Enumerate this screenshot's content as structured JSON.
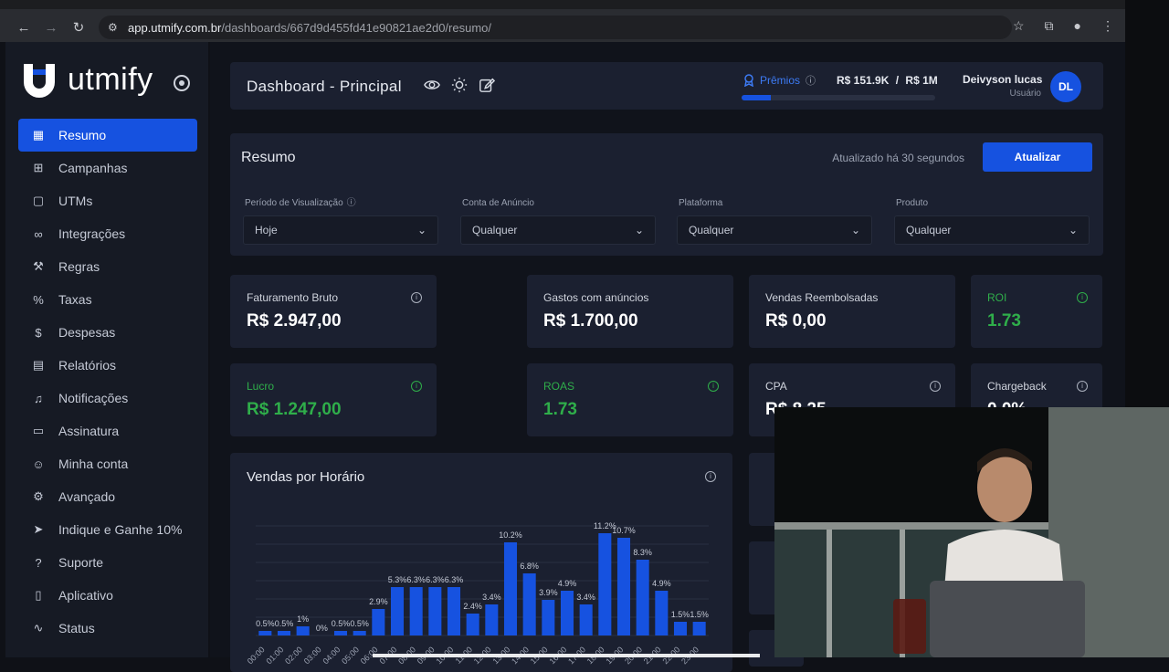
{
  "browser": {
    "url_host": "app.utmify.com.br",
    "url_path": "/dashboards/667d9d455fd41e90821ae2d0/resumo/"
  },
  "sidebar": {
    "logo_text": "utmify",
    "items": [
      {
        "label": "Resumo",
        "icon": "layout-icon"
      },
      {
        "label": "Campanhas",
        "icon": "folder-plus-icon"
      },
      {
        "label": "UTMs",
        "icon": "clipboard-icon"
      },
      {
        "label": "Integrações",
        "icon": "link-icon"
      },
      {
        "label": "Regras",
        "icon": "wrench-icon"
      },
      {
        "label": "Taxas",
        "icon": "percent-icon"
      },
      {
        "label": "Despesas",
        "icon": "dollar-icon"
      },
      {
        "label": "Relatórios",
        "icon": "file-icon"
      },
      {
        "label": "Notificações",
        "icon": "bell-icon"
      },
      {
        "label": "Assinatura",
        "icon": "card-icon"
      },
      {
        "label": "Minha conta",
        "icon": "user-icon"
      },
      {
        "label": "Avançado",
        "icon": "gear-icon"
      },
      {
        "label": "Indique e Ganhe 10%",
        "icon": "send-icon"
      },
      {
        "label": "Suporte",
        "icon": "help-icon"
      },
      {
        "label": "Aplicativo",
        "icon": "phone-icon"
      },
      {
        "label": "Status",
        "icon": "activity-icon"
      }
    ]
  },
  "topbar": {
    "title": "Dashboard - Principal",
    "premios_label": "Prêmios",
    "goal_current": "R$ 151.9K",
    "goal_separator": "/",
    "goal_target": "R$ 1M",
    "goal_progress": 0.15,
    "user_name": "Deivyson lucas",
    "user_role": "Usuário",
    "avatar_initials": "DL"
  },
  "resumo": {
    "title": "Resumo",
    "updated_text": "Atualizado há 30 segundos",
    "update_button": "Atualizar",
    "filters": [
      {
        "label": "Período de Visualização",
        "value": "Hoje"
      },
      {
        "label": "Conta de Anúncio",
        "value": "Qualquer"
      },
      {
        "label": "Plataforma",
        "value": "Qualquer"
      },
      {
        "label": "Produto",
        "value": "Qualquer"
      }
    ]
  },
  "kpis": {
    "faturamento": {
      "label": "Faturamento Bruto",
      "value": "R$ 2.947,00"
    },
    "gastos": {
      "label": "Gastos com anúncios",
      "value": "R$ 1.700,00"
    },
    "reembolsadas": {
      "label": "Vendas Reembolsadas",
      "value": "R$ 0,00"
    },
    "roi": {
      "label": "ROI",
      "value": "1.73"
    },
    "lucro": {
      "label": "Lucro",
      "value": "R$ 1.247,00"
    },
    "roas": {
      "label": "ROAS",
      "value": "1.73"
    },
    "cpa": {
      "label": "CPA",
      "value": "R$ 8,25"
    },
    "chargeback": {
      "label": "Chargeback",
      "value": "0,0%"
    }
  },
  "colors": {
    "accent": "#1652e0",
    "positive": "#2fae4a"
  },
  "chart_data": {
    "type": "bar",
    "title": "Vendas por Horário",
    "categories": [
      "00:00",
      "01:00",
      "02:00",
      "03:00",
      "04:00",
      "05:00",
      "06:00",
      "07:00",
      "08:00",
      "09:00",
      "10:00",
      "11:00",
      "12:00",
      "13:00",
      "14:00",
      "15:00",
      "16:00",
      "17:00",
      "18:00",
      "19:00",
      "20:00",
      "21:00",
      "22:00",
      "23:00"
    ],
    "values": [
      0.5,
      0.5,
      1,
      0,
      0.5,
      0.5,
      2.9,
      5.3,
      5.3,
      5.3,
      5.3,
      2.4,
      3.4,
      10.2,
      6.8,
      3.9,
      4.9,
      3.4,
      11.2,
      10.7,
      8.3,
      4.9,
      1.5,
      1.5
    ],
    "labels": [
      "0.5%",
      "0.5%",
      "1%",
      "0%",
      "0.5%",
      "0.5%",
      "2.9%",
      "5.3%",
      "6.3%",
      "6.3%",
      "6.3%",
      "2.4%",
      "3.4%",
      "10.2%",
      "6.8%",
      "3.9%",
      "4.9%",
      "3.4%",
      "11.2%",
      "10.7%",
      "8.3%",
      "4.9%",
      "1.5%",
      "1.5%"
    ],
    "ylim": [
      0,
      12
    ],
    "grid": true,
    "color": "#1652e0"
  }
}
